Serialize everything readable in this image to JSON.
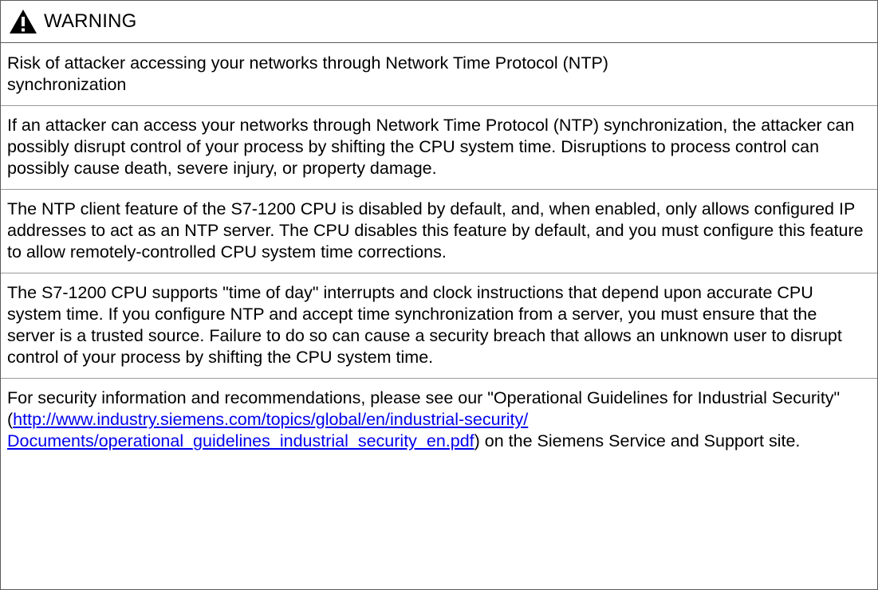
{
  "header": {
    "icon": "warning-triangle-icon",
    "title": "WARNING"
  },
  "subject_line1": "Risk of attacker accessing your networks through Network Time Protocol (NTP)",
  "subject_line2": "synchronization",
  "paragraphs": [
    "If an attacker can access your networks through Network Time Protocol (NTP) synchronization, the attacker can possibly disrupt control of your process by shifting the CPU system time. Disruptions to process control can possibly cause death, severe injury, or property damage.",
    "The NTP client feature of the S7-1200 CPU is disabled by default, and, when enabled, only allows configured IP addresses to act as an NTP server. The CPU disables this feature by default, and you must configure this feature to allow remotely-controlled CPU system time corrections.",
    "The S7-1200 CPU supports \"time of day\" interrupts and clock instructions that depend upon accurate CPU system time. If you configure NTP and accept time synchronization from a server, you must ensure that the server is a trusted source. Failure to do so can cause a security breach that allows an unknown user to disrupt control of your process by shifting the CPU system time."
  ],
  "security_note": {
    "before": "For security information and recommendations, please see our \"Operational Guidelines for Industrial Security\" (",
    "link_line1": "http://www.industry.siemens.com/topics/global/en/industrial-security/",
    "link_line2": "Documents/operational_guidelines_industrial_security_en.pdf",
    "after": ") on the Siemens Service and Support site."
  },
  "colors": {
    "link": "#0000ee",
    "border": "#5a5a5a",
    "icon": "#000000"
  }
}
